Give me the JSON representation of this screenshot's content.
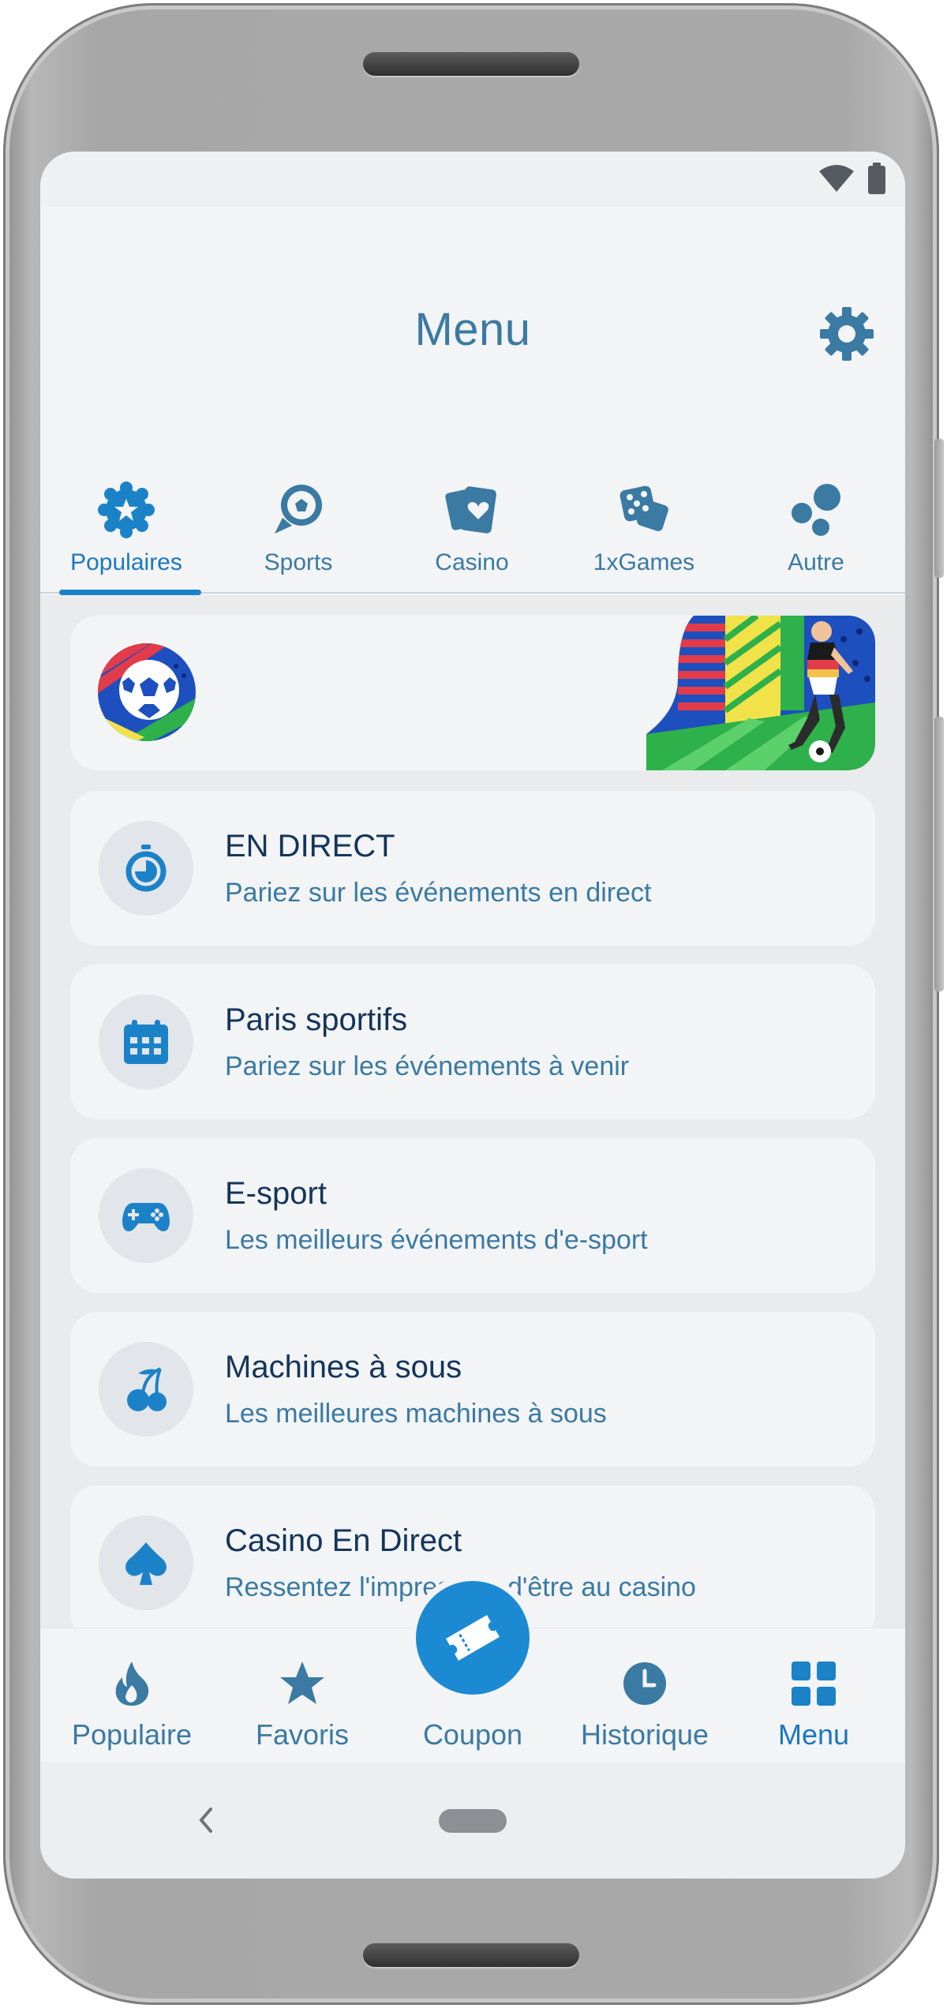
{
  "header": {
    "title": "Menu"
  },
  "tabs": [
    {
      "label": "Populaires",
      "icon": "star-badge-icon",
      "active": true
    },
    {
      "label": "Sports",
      "icon": "soccer-ball-icon",
      "active": false
    },
    {
      "label": "Casino",
      "icon": "playing-card-icon",
      "active": false
    },
    {
      "label": "1xGames",
      "icon": "dice-icon",
      "active": false
    },
    {
      "label": "Autre",
      "icon": "bubbles-icon",
      "active": false
    }
  ],
  "menu_items": [
    {
      "title": "EN DIRECT",
      "subtitle": "Pariez sur les événements en direct",
      "icon": "stopwatch-icon"
    },
    {
      "title": "Paris sportifs",
      "subtitle": "Pariez sur les événements à venir",
      "icon": "calendar-icon"
    },
    {
      "title": "E-sport",
      "subtitle": "Les meilleurs événements d'e-sport",
      "icon": "gamepad-icon"
    },
    {
      "title": "Machines à sous",
      "subtitle": "Les meilleures machines à sous",
      "icon": "cherries-icon"
    },
    {
      "title": "Casino En Direct",
      "subtitle": "Ressentez l'impression d'être au casino",
      "icon": "spade-icon"
    }
  ],
  "bottom_nav": [
    {
      "label": "Populaire",
      "icon": "flame-icon",
      "active": false
    },
    {
      "label": "Favoris",
      "icon": "star-icon",
      "active": false
    },
    {
      "label": "Coupon",
      "icon": "ticket-icon",
      "active": false
    },
    {
      "label": "Historique",
      "icon": "clock-icon",
      "active": false
    },
    {
      "label": "Menu",
      "icon": "grid-icon",
      "active": true
    }
  ],
  "colors": {
    "accent": "#1b82c8",
    "text_primary": "#13355a",
    "text_secondary": "#3a7aa3",
    "background": "#f3f4f5"
  }
}
